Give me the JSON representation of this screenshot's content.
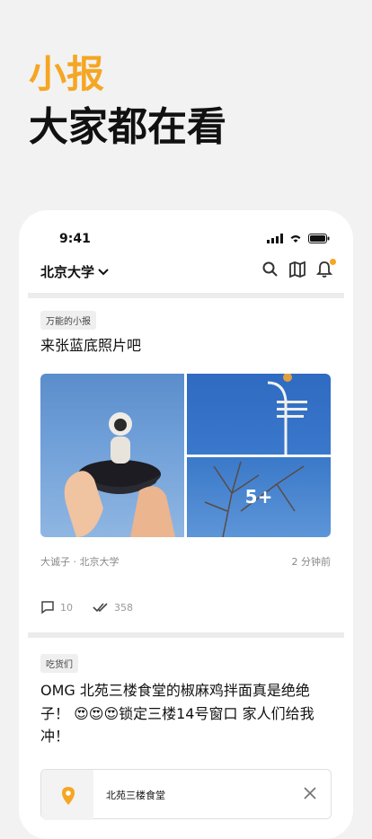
{
  "hero": {
    "title": "小报",
    "subtitle": "大家都在看"
  },
  "status_bar": {
    "time": "9:41"
  },
  "nav": {
    "school": "北京大学"
  },
  "posts": [
    {
      "tag": "万能的小报",
      "text": "来张蓝底照片吧",
      "more_images": "5+",
      "author": "大诚子",
      "school": "北京大学",
      "time_ago": "2 分钟前",
      "comments": "10",
      "reads": "358"
    },
    {
      "tag": "吃货们",
      "text_line1": "OMG 北苑三楼食堂的椒麻鸡拌面真是绝绝",
      "text_line2": "子！ 😍😍😍锁定三楼14号窗口 家人们给我",
      "text_line3": "冲！",
      "place": "北苑三楼食堂"
    }
  ],
  "colors": {
    "accent": "#f5a623",
    "background": "#f2f2f2"
  }
}
